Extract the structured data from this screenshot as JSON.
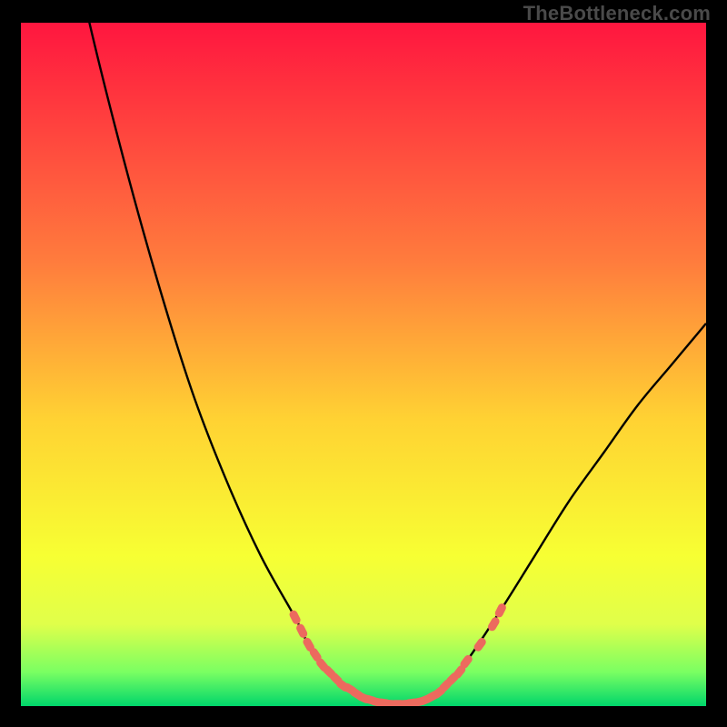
{
  "watermark": "TheBottleneck.com",
  "colors": {
    "frame": "#000000",
    "gradient_top": "#ff163f",
    "gradient_mid_upper": "#ff7c3d",
    "gradient_mid": "#ffd233",
    "gradient_mid_lower": "#f7ff33",
    "gradient_lower": "#e0ff4a",
    "gradient_green_light": "#7aff62",
    "gradient_green": "#00d66b",
    "curve": "#000000",
    "marker": "#ec6a5e"
  },
  "chart_data": {
    "type": "line",
    "title": "",
    "xlabel": "",
    "ylabel": "",
    "xlim": [
      0,
      100
    ],
    "ylim": [
      0,
      100
    ],
    "series": [
      {
        "name": "bottleneck-curve",
        "x": [
          0,
          5,
          10,
          15,
          20,
          25,
          30,
          35,
          40,
          42,
          45,
          48,
          50,
          52,
          54,
          56,
          58,
          60,
          62,
          65,
          70,
          75,
          80,
          85,
          90,
          95,
          100
        ],
        "y": [
          150,
          123,
          100,
          80,
          62,
          46,
          33,
          22,
          13,
          9,
          5,
          2.5,
          1.2,
          0.6,
          0.3,
          0.3,
          0.6,
          1.4,
          3,
          6.5,
          14,
          22,
          30,
          37,
          44,
          50,
          56
        ]
      }
    ],
    "markers": {
      "name": "highlighted-range",
      "points": [
        {
          "x": 40,
          "y": 13
        },
        {
          "x": 41,
          "y": 11
        },
        {
          "x": 42,
          "y": 9
        },
        {
          "x": 43,
          "y": 7.5
        },
        {
          "x": 44,
          "y": 6
        },
        {
          "x": 45,
          "y": 5
        },
        {
          "x": 46,
          "y": 4
        },
        {
          "x": 47,
          "y": 3
        },
        {
          "x": 48,
          "y": 2.5
        },
        {
          "x": 49,
          "y": 1.8
        },
        {
          "x": 50,
          "y": 1.2
        },
        {
          "x": 51,
          "y": 0.9
        },
        {
          "x": 52,
          "y": 0.6
        },
        {
          "x": 53,
          "y": 0.45
        },
        {
          "x": 54,
          "y": 0.3
        },
        {
          "x": 55,
          "y": 0.3
        },
        {
          "x": 56,
          "y": 0.3
        },
        {
          "x": 57,
          "y": 0.45
        },
        {
          "x": 58,
          "y": 0.6
        },
        {
          "x": 59,
          "y": 0.9
        },
        {
          "x": 60,
          "y": 1.4
        },
        {
          "x": 61,
          "y": 2
        },
        {
          "x": 62,
          "y": 3
        },
        {
          "x": 63,
          "y": 4
        },
        {
          "x": 64,
          "y": 5
        },
        {
          "x": 65,
          "y": 6.5
        },
        {
          "x": 67,
          "y": 9
        },
        {
          "x": 69,
          "y": 12
        },
        {
          "x": 70,
          "y": 14
        }
      ]
    }
  }
}
